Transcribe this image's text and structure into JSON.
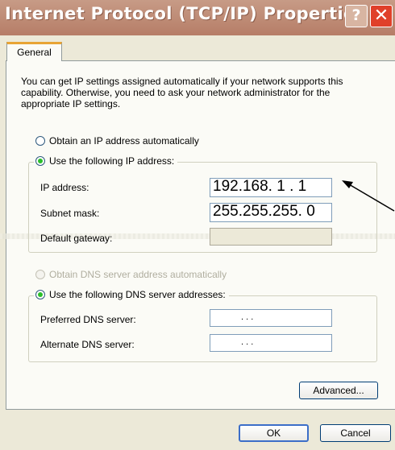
{
  "window": {
    "title": "Internet Protocol (TCP/IP) Properties",
    "help_glyph": "?",
    "close_glyph": "✕"
  },
  "tabs": [
    "General"
  ],
  "intro_text": "You can get IP settings assigned automatically if your network supports this capability. Otherwise, you need to ask your network administrator for the appropriate IP settings.",
  "ip": {
    "auto_label": "Obtain an IP address automatically",
    "manual_label": "Use the following IP address:",
    "selected": "manual",
    "fields": [
      {
        "label": "IP address:",
        "value": "192.168. 1 . 1"
      },
      {
        "label": "Subnet mask:",
        "value": "255.255.255. 0"
      },
      {
        "label": "Default gateway:",
        "value": ""
      }
    ]
  },
  "dns": {
    "auto_label": "Obtain DNS server address automatically",
    "manual_label": "Use the following DNS server addresses:",
    "selected": "manual",
    "fields": [
      {
        "label": "Preferred DNS server:",
        "value": ""
      },
      {
        "label": "Alternate DNS server:",
        "value": ""
      }
    ],
    "empty_dots": ".        .        ."
  },
  "buttons": {
    "advanced": "Advanced...",
    "ok": "OK",
    "cancel": "Cancel"
  },
  "colors": {
    "titlebar": "#b67d67",
    "close": "#e0402a",
    "tab_accent": "#e8a434",
    "radio_check": "#2bbf2b"
  }
}
